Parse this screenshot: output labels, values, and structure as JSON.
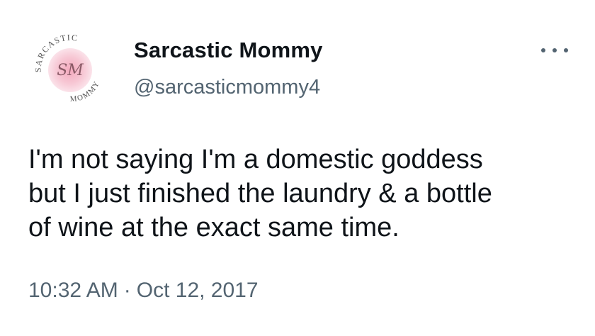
{
  "author": {
    "display_name": "Sarcastic Mommy",
    "handle": "@sarcasticmommy4",
    "avatar": {
      "icon": "sarcastic-mommy-logo",
      "ring_text_top": "SARCASTIC",
      "ring_text_bottom": "MOMMY",
      "monogram": "SM",
      "accent_color": "#f2b6c6"
    }
  },
  "tweet": {
    "text": "I'm not saying I'm a domestic goddess\nbut I just finished the laundry & a bottle\nof wine at the exact same time.",
    "time": "10:32 AM",
    "separator": "·",
    "date": "Oct 12, 2017"
  },
  "menu": {
    "icon": "more-options-icon"
  },
  "colors": {
    "primary_text": "#0f1419",
    "secondary_text": "#536471",
    "background": "#ffffff"
  }
}
